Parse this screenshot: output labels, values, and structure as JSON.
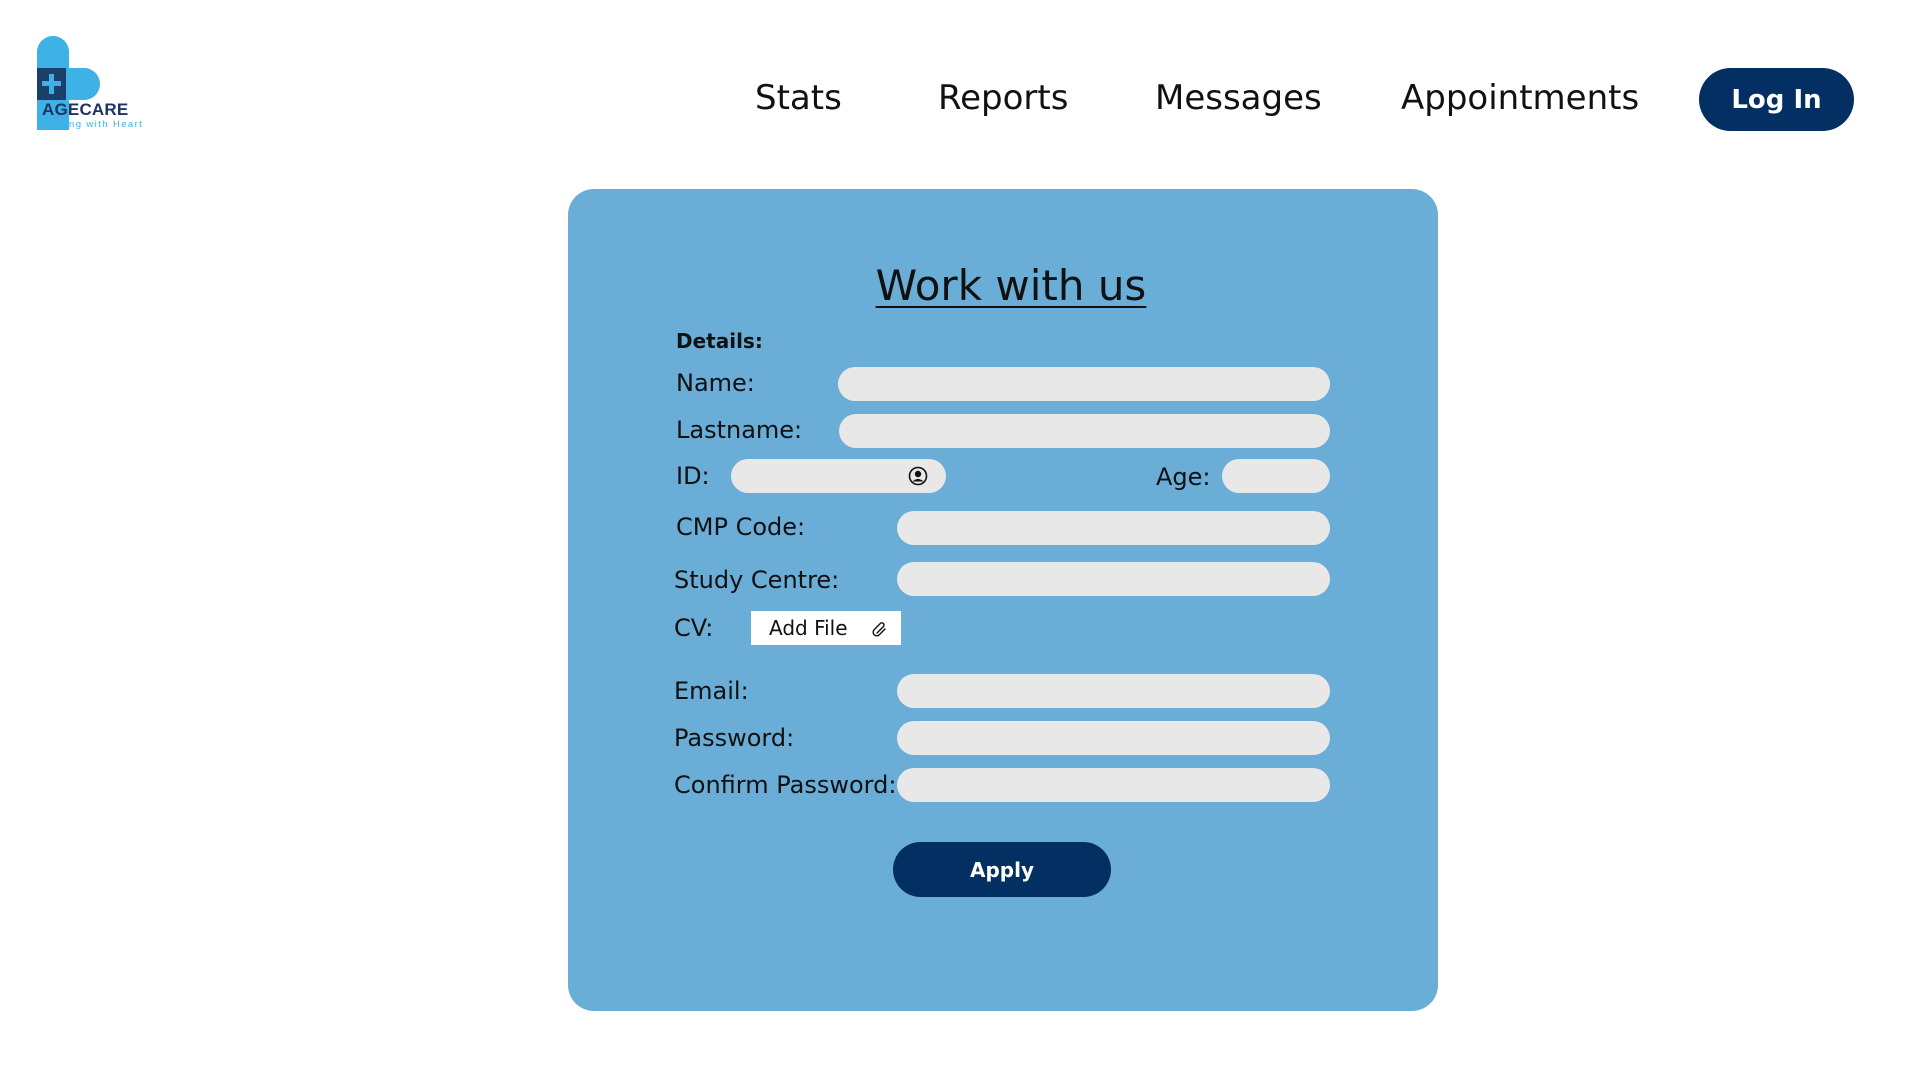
{
  "brand": {
    "name": "AGECARE",
    "tagline": "Caring with Heart"
  },
  "nav": {
    "items": [
      {
        "label": "Stats"
      },
      {
        "label": "Reports"
      },
      {
        "label": "Messages"
      },
      {
        "label": "Appointments"
      }
    ],
    "login_label": "Log In"
  },
  "form": {
    "title": "Work with us",
    "section_label": "Details:",
    "labels": {
      "name": "Name:",
      "lastname": "Lastname:",
      "id": "ID:",
      "age": "Age:",
      "cmp_code": "CMP Code:",
      "study_centre": "Study Centre:",
      "cv": "CV:",
      "email": "Email:",
      "password": "Password:",
      "confirm_password": "Confirm Password:"
    },
    "values": {
      "name": "",
      "lastname": "",
      "id": "",
      "age": "",
      "cmp_code": "",
      "study_centre": "",
      "email": "",
      "password": "",
      "confirm_password": ""
    },
    "add_file_label": "Add File",
    "apply_label": "Apply"
  },
  "colors": {
    "card": "#6aadd7",
    "primary": "#032f62",
    "field": "#e8e8e8",
    "brand_light": "#3eb1e6",
    "brand_dark": "#1b3f6b"
  }
}
